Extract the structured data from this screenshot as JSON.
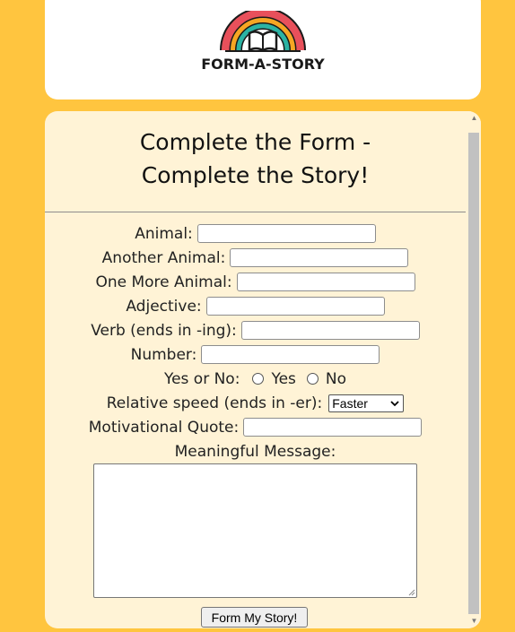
{
  "header": {
    "logo_text": "FORM-A-STORY",
    "logo_icon": "rainbow-book-icon"
  },
  "form": {
    "title_line1": "Complete the Form -",
    "title_line2": "Complete the Story!",
    "fields": {
      "animal": {
        "label": "Animal:",
        "value": ""
      },
      "another_animal": {
        "label": "Another Animal:",
        "value": ""
      },
      "one_more_animal": {
        "label": "One More Animal:",
        "value": ""
      },
      "adjective": {
        "label": "Adjective:",
        "value": ""
      },
      "verb": {
        "label": "Verb (ends in -ing):",
        "value": ""
      },
      "number": {
        "label": "Number:",
        "value": ""
      },
      "motivational_quote": {
        "label": "Motivational Quote:",
        "value": ""
      }
    },
    "yes_no": {
      "label": "Yes or No:",
      "options": [
        "Yes",
        "No"
      ],
      "selected": null
    },
    "relative_speed": {
      "label": "Relative speed (ends in -er):",
      "selected": "Faster"
    },
    "message": {
      "label": "Meaningful Message:",
      "value": ""
    },
    "submit_label": "Form My Story!"
  },
  "colors": {
    "page_background": "#ffc53f",
    "form_background": "#fff3d6",
    "header_background": "#ffffff"
  }
}
